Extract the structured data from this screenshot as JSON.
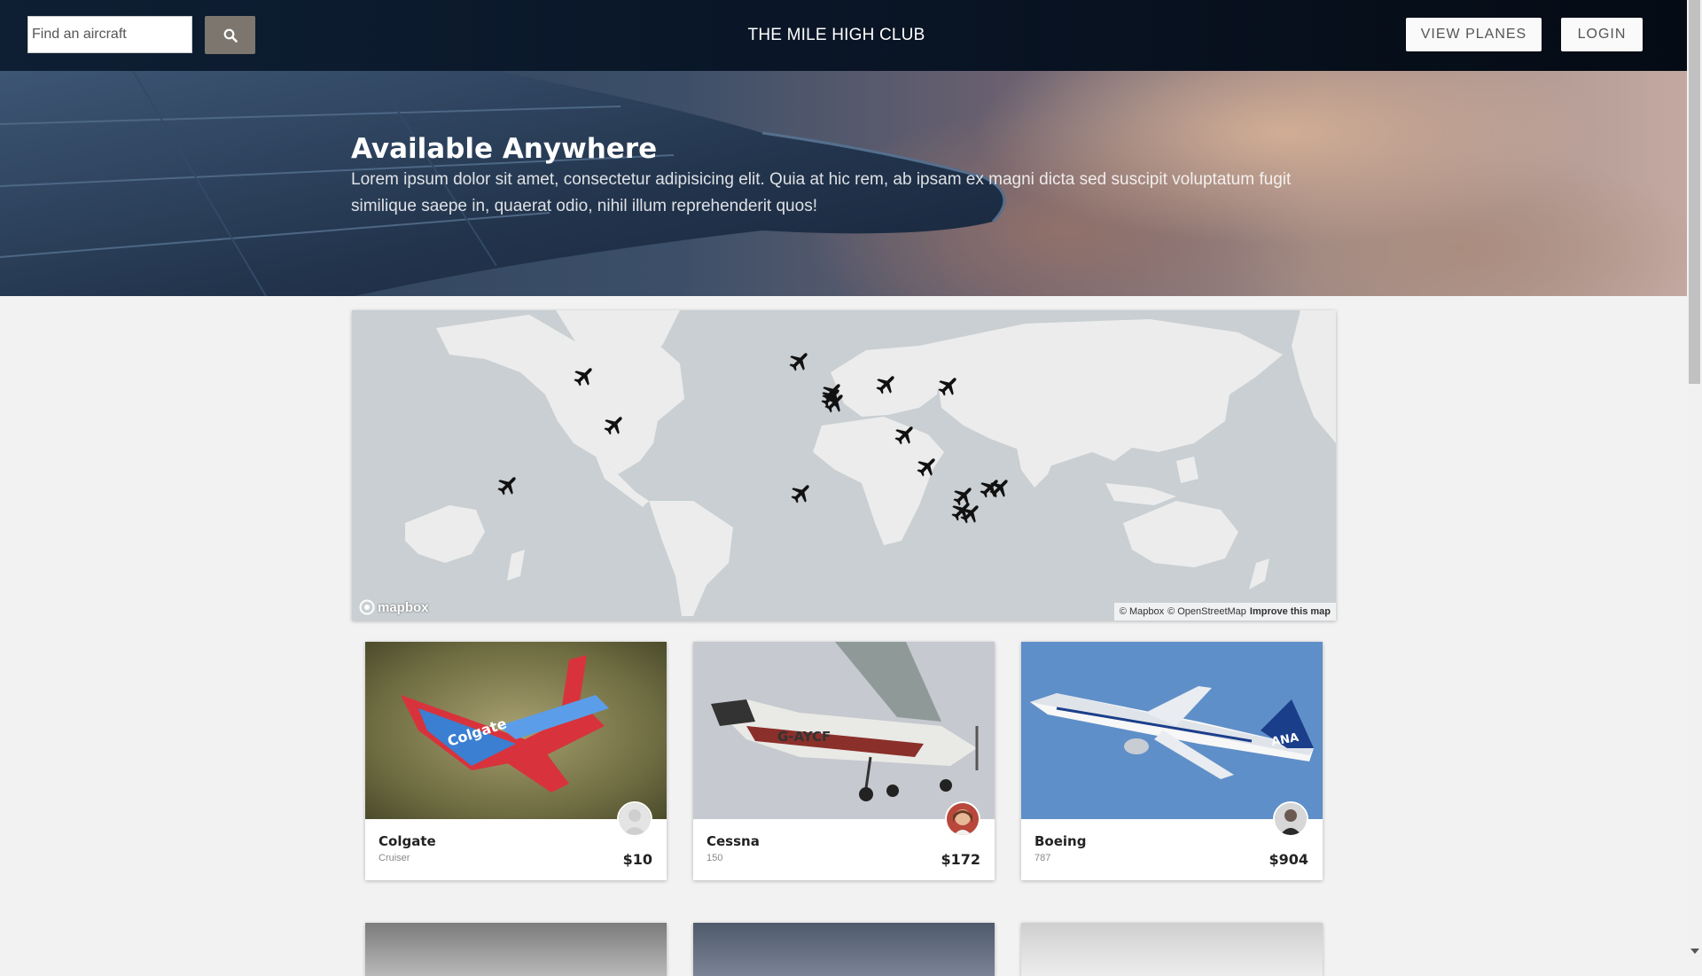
{
  "navbar": {
    "search_placeholder": "Find an aircraft",
    "brand": "THE MILE HIGH CLUB",
    "view_planes_label": "VIEW PLANES",
    "login_label": "LOGIN"
  },
  "hero": {
    "title": "Available Anywhere",
    "text": "Lorem ipsum dolor sit amet, consectetur adipisicing elit. Quia at hic rem, ab ipsam ex magni dicta sed suscipit voluptatum fugit similique saepe in, quaerat odio, nihil illum reprehenderit quos!"
  },
  "map": {
    "logo_text": "mapbox",
    "attribution_mapbox": "© Mapbox",
    "attribution_osm": "© OpenStreetMap",
    "improve_label": "Improve this map",
    "marker_icon": "airplane-icon",
    "marker_count": 17
  },
  "cards": [
    {
      "title": "Colgate",
      "subtitle": "Cruiser",
      "price": "$10"
    },
    {
      "title": "Cessna",
      "subtitle": "150",
      "price": "$172"
    },
    {
      "title": "Boeing",
      "subtitle": "787",
      "price": "$904"
    }
  ],
  "colors": {
    "navbar": "#0a1628",
    "search_button": "#7c766e",
    "map_water": "#c9cfd2",
    "map_land": "#ececec"
  }
}
